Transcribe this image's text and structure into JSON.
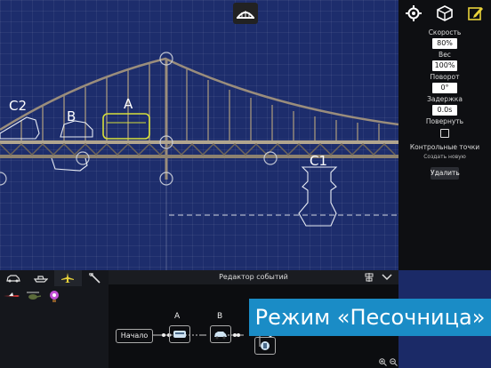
{
  "scene": {
    "labels": {
      "c2": "C2",
      "b": "B",
      "a": "A",
      "c1": "C1"
    }
  },
  "right_panel": {
    "speed_label": "Скорость",
    "speed_value": "80%",
    "weight_label": "Вес",
    "weight_value": "100%",
    "rotation_label": "Поворот",
    "rotation_value": "0°",
    "delay_label": "Задержка",
    "delay_value": "0.0s",
    "flip_label": "Повернуть",
    "checkpoints_label": "Контрольные точки",
    "create_new_label": "Создать новую",
    "delete_label": "Удалить"
  },
  "event_editor": {
    "title": "Редактор событий",
    "start_label": "Начало",
    "node_a": "A",
    "node_b": "B"
  },
  "banner": {
    "text": "Режим «Песочница»"
  },
  "colors": {
    "accent": "#1a8cc6",
    "bus": "#d7df3a",
    "bg": "#1d2d6c"
  }
}
